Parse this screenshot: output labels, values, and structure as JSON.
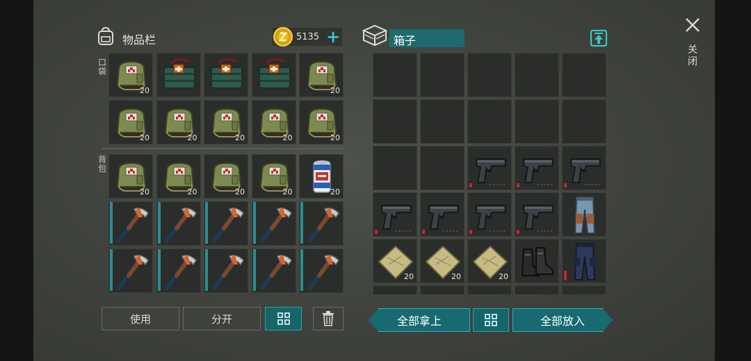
{
  "inventory": {
    "title": "物品栏",
    "coins": "5135",
    "plus_label": "+",
    "pocket_label": "口袋",
    "backpack_label": "背包",
    "slots": [
      {
        "item": "medkit-bag",
        "count": "20"
      },
      {
        "item": "first-aid-case",
        "count": ""
      },
      {
        "item": "first-aid-case",
        "count": ""
      },
      {
        "item": "first-aid-case",
        "count": ""
      },
      {
        "item": "medkit-bag",
        "count": "20"
      },
      {
        "item": "medkit-bag",
        "count": "20"
      },
      {
        "item": "medkit-bag",
        "count": "20"
      },
      {
        "item": "medkit-bag",
        "count": "20"
      },
      {
        "item": "medkit-bag",
        "count": "20"
      },
      {
        "item": "medkit-bag",
        "count": "20"
      },
      {
        "item": "medkit-bag",
        "count": "20"
      },
      {
        "item": "medkit-bag",
        "count": "20"
      },
      {
        "item": "medkit-bag",
        "count": "20"
      },
      {
        "item": "medkit-bag",
        "count": "20"
      },
      {
        "item": "soda-can",
        "count": "20"
      },
      {
        "item": "hatchet",
        "count": ""
      },
      {
        "item": "hatchet",
        "count": ""
      },
      {
        "item": "hatchet",
        "count": ""
      },
      {
        "item": "hatchet",
        "count": ""
      },
      {
        "item": "hatchet",
        "count": ""
      },
      {
        "item": "hatchet",
        "count": ""
      },
      {
        "item": "hatchet",
        "count": ""
      },
      {
        "item": "hatchet",
        "count": ""
      },
      {
        "item": "hatchet",
        "count": ""
      },
      {
        "item": "hatchet",
        "count": ""
      }
    ],
    "use_label": "使用",
    "split_label": "分开"
  },
  "box": {
    "name": "箱子",
    "slots": [
      {
        "item": "",
        "count": ""
      },
      {
        "item": "",
        "count": ""
      },
      {
        "item": "",
        "count": ""
      },
      {
        "item": "",
        "count": ""
      },
      {
        "item": "",
        "count": ""
      },
      {
        "item": "",
        "count": ""
      },
      {
        "item": "",
        "count": ""
      },
      {
        "item": "",
        "count": ""
      },
      {
        "item": "",
        "count": ""
      },
      {
        "item": "",
        "count": ""
      },
      {
        "item": "",
        "count": ""
      },
      {
        "item": "",
        "count": ""
      },
      {
        "item": "pistol",
        "count": ""
      },
      {
        "item": "pistol",
        "count": ""
      },
      {
        "item": "pistol",
        "count": ""
      },
      {
        "item": "pistol",
        "count": ""
      },
      {
        "item": "pistol",
        "count": ""
      },
      {
        "item": "pistol",
        "count": ""
      },
      {
        "item": "pistol",
        "count": ""
      },
      {
        "item": "pants-blue",
        "count": ""
      },
      {
        "item": "cloth",
        "count": "20"
      },
      {
        "item": "cloth",
        "count": "20"
      },
      {
        "item": "cloth",
        "count": "20"
      },
      {
        "item": "boots",
        "count": ""
      },
      {
        "item": "pants-dark",
        "count": ""
      }
    ],
    "take_all_label": "全部拿上",
    "put_all_label": "全部放入"
  },
  "close_label": "关闭",
  "colors": {
    "accent": "#2fb3b9",
    "durability": "#2c8d95",
    "damage": "#c0272d"
  }
}
